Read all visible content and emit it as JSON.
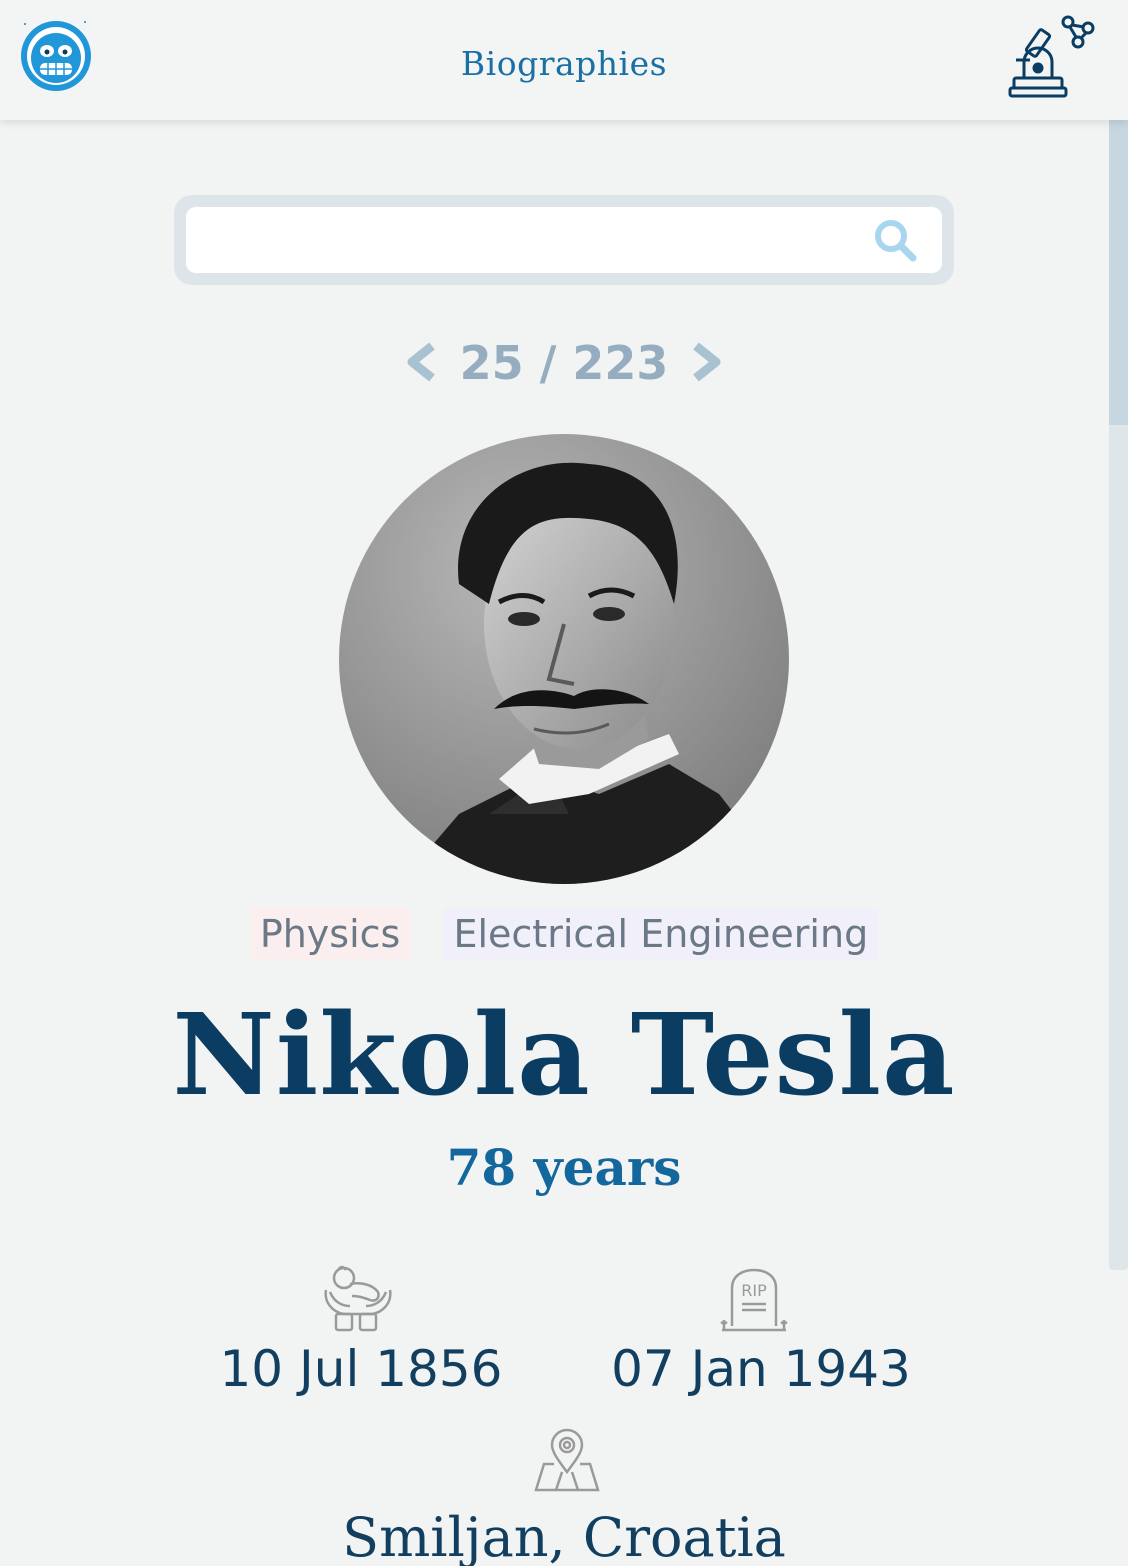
{
  "header": {
    "title": "Biographies",
    "logo_icon": "astronaut-monkey-icon",
    "science_icon": "microscope-molecule-icon"
  },
  "search": {
    "placeholder": "",
    "value": ""
  },
  "pager": {
    "current": 25,
    "total": 223,
    "text": "25 / 223"
  },
  "person": {
    "tags": [
      "Physics",
      "Electrical Engineering"
    ],
    "name": "Nikola Tesla",
    "age": "78 years",
    "birth_date": "10 Jul 1856",
    "death_date": "07 Jan 1943",
    "birth_place": "Smiljan, Croatia"
  },
  "colors": {
    "accent": "#1a6fa5",
    "name": "#0b3d63",
    "pager": "#96adbf",
    "tag_physics_bg": "#fbeeee",
    "tag_ee_bg": "#f1effa"
  }
}
